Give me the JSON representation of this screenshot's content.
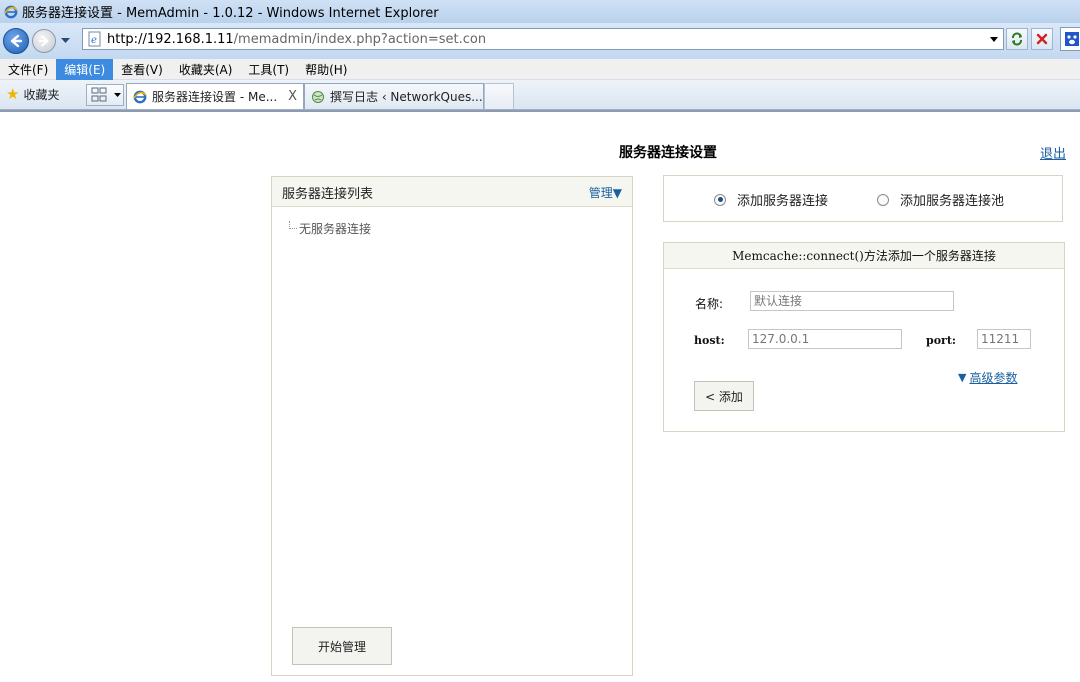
{
  "window": {
    "title": "服务器连接设置 - MemAdmin - 1.0.12 - Windows Internet Explorer"
  },
  "address": {
    "url_host": "http://192.168.1.11",
    "url_path": "/memadmin/index.php?action=set.con"
  },
  "menu": {
    "items": [
      "文件(F)",
      "编辑(E)",
      "查看(V)",
      "收藏夹(A)",
      "工具(T)",
      "帮助(H)"
    ],
    "active_index": 1
  },
  "favorites": {
    "label": "收藏夹"
  },
  "tabs": [
    {
      "label": "服务器连接设置 - Me...",
      "active": true,
      "close_glyph": "X"
    },
    {
      "label": "撰写日志 ‹ NetworkQues...",
      "active": false
    }
  ],
  "page": {
    "title": "服务器连接设置",
    "logout": "退出",
    "list_panel": {
      "title": "服务器连接列表",
      "manage": "管理▼",
      "empty_item": "无服务器连接",
      "start_button": "开始管理"
    },
    "modes": {
      "add_connection": "添加服务器连接",
      "add_pool": "添加服务器连接池",
      "selected": "add_connection"
    },
    "form": {
      "heading": "Memcache::connect()方法添加一个服务器连接",
      "name_label": "名称:",
      "name_value": "默认连接",
      "host_label": "host:",
      "host_value": "127.0.0.1",
      "port_label": "port:",
      "port_value": "11211",
      "advanced": "高级参数",
      "advanced_glyph": "▼",
      "add_button": "< 添加"
    }
  },
  "colors": {
    "link": "#1a5f9e",
    "menu_active": "#3d8be0",
    "panel_border": "#d7d4c4",
    "panel_header": "#f6f6f1"
  },
  "icons": {
    "window": "ie-logo-icon",
    "back": "back-arrow-icon",
    "forward": "forward-arrow-icon",
    "refresh": "refresh-icon",
    "stop": "stop-icon",
    "favorites": "star-icon",
    "quick_tabs": "quick-tabs-icon"
  }
}
